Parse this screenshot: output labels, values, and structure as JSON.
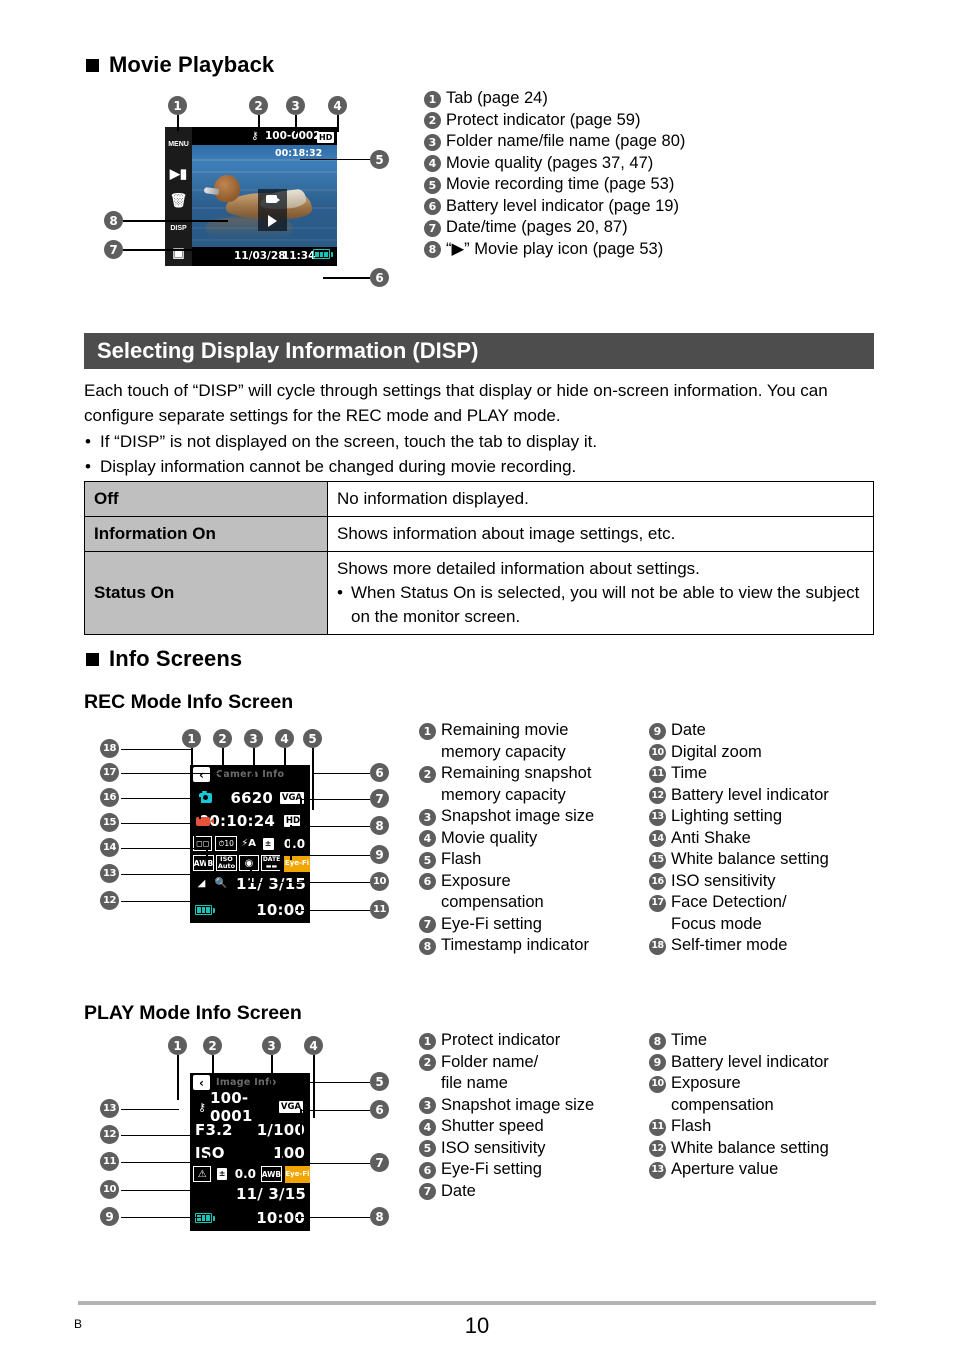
{
  "movie_playback": {
    "heading": "Movie Playback",
    "lcd": {
      "tab_buttons": [
        "MENU",
        "slideshow-icon",
        "delete-icon",
        "DISP",
        "rec-icon"
      ],
      "menu_label": "MENU",
      "disp_label": "DISP",
      "protect_icon": "protect-key-icon",
      "file_name": "100-0002",
      "movie_quality": "HD",
      "recording_time": "00:18:32",
      "date": "11/03/28",
      "time": "11:34",
      "play_icon": "play-triangle-icon",
      "movie_icon": "movie-camera-icon"
    },
    "legend": [
      {
        "n": "1",
        "text": "Tab (page 24)"
      },
      {
        "n": "2",
        "text": "Protect indicator (page 59)"
      },
      {
        "n": "3",
        "text": "Folder name/file name (page 80)"
      },
      {
        "n": "4",
        "text": "Movie quality (pages 37, 47)"
      },
      {
        "n": "5",
        "text": "Movie recording time (page 53)"
      },
      {
        "n": "6",
        "text": "Battery level indicator (page 19)"
      },
      {
        "n": "7",
        "text": "Date/time (pages 20, 87)"
      },
      {
        "n": "8",
        "text": "“▶” Movie play icon (page 53)"
      }
    ],
    "markers": [
      "1",
      "2",
      "3",
      "4",
      "5",
      "6",
      "7",
      "8"
    ]
  },
  "disp_section": {
    "bar_title": "Selecting Display Information (DISP)",
    "paragraph": "Each touch of “DISP” will cycle through settings that display or hide on-screen information. You can configure separate settings for the REC mode and PLAY mode.",
    "bullets": [
      "If “DISP” is not displayed on the screen, touch the tab to display it.",
      "Display information cannot be changed during movie recording."
    ],
    "table": [
      {
        "key": "Off",
        "value": "No information displayed.",
        "sub": null
      },
      {
        "key": "Information On",
        "value": "Shows information about image settings, etc.",
        "sub": null
      },
      {
        "key": "Status On",
        "value": "Shows more detailed information about settings.",
        "sub": "When Status On is selected, you will not be able to view the subject on the monitor screen."
      }
    ]
  },
  "info_screens": {
    "heading": "Info Screens",
    "rec": {
      "title": "REC Mode Info Screen",
      "lcd": {
        "header_title": "Camera Info",
        "back_icon": "back-chevron-icon",
        "snapshot_icon": "camera-icon",
        "snapshot_remaining": "6620",
        "snapshot_size": "VGA",
        "movie_icon": "movie-icon",
        "movie_remaining": "00:10:24",
        "movie_quality": "HD",
        "face_detect": "face-detect-icon",
        "self_timer": "10",
        "flash": "flash-auto-icon",
        "ev_icon": "ev-icon",
        "ev_value": "0.0",
        "white_balance": "AWB",
        "iso_label": "ISO",
        "iso_value": "Auto",
        "anti_shake": "anti-shake-icon",
        "timestamp": "DATE",
        "eyefi": "Eye-Fi",
        "lighting": "lighting-icon",
        "digital_zoom": "digital-zoom-icon",
        "date": "11/ 3/15",
        "battery": "battery-icon",
        "time": "10:00"
      },
      "legend_left": [
        {
          "n": "1",
          "text": "Remaining movie",
          "cont": "memory capacity"
        },
        {
          "n": "2",
          "text": "Remaining snapshot",
          "cont": "memory capacity"
        },
        {
          "n": "3",
          "text": "Snapshot image size",
          "cont": null
        },
        {
          "n": "4",
          "text": "Movie quality",
          "cont": null
        },
        {
          "n": "5",
          "text": "Flash",
          "cont": null
        },
        {
          "n": "6",
          "text": "Exposure",
          "cont": "compensation"
        },
        {
          "n": "7",
          "text": "Eye-Fi setting",
          "cont": null
        },
        {
          "n": "8",
          "text": "Timestamp indicator",
          "cont": null
        }
      ],
      "legend_right": [
        {
          "n": "9",
          "text": "Date",
          "cont": null
        },
        {
          "n": "10",
          "text": "Digital zoom",
          "cont": null
        },
        {
          "n": "11",
          "text": "Time",
          "cont": null
        },
        {
          "n": "12",
          "text": "Battery level indicator",
          "cont": null
        },
        {
          "n": "13",
          "text": "Lighting setting",
          "cont": null
        },
        {
          "n": "14",
          "text": "Anti Shake",
          "cont": null
        },
        {
          "n": "15",
          "text": "White balance setting",
          "cont": null
        },
        {
          "n": "16",
          "text": "ISO sensitivity",
          "cont": null
        },
        {
          "n": "17",
          "text": "Face Detection/",
          "cont": "Focus mode"
        },
        {
          "n": "18",
          "text": "Self-timer mode",
          "cont": null
        }
      ]
    },
    "play": {
      "title": "PLAY Mode Info Screen",
      "lcd": {
        "header_title": "Image Info",
        "back_icon": "back-chevron-icon",
        "protect_icon": "protect-key-icon",
        "file_name": "100-0001",
        "image_size": "VGA",
        "aperture": "F3.2",
        "shutter_speed": "1/100",
        "iso_label": "ISO",
        "iso_value": "100",
        "flash": "flash-off-icon",
        "ev_icon": "ev-icon",
        "ev_value": "0.0",
        "white_balance": "AWB",
        "eyefi": "Eye-Fi",
        "date": "11/ 3/15",
        "battery": "battery-icon",
        "time": "10:00"
      },
      "legend_left": [
        {
          "n": "1",
          "text": "Protect indicator",
          "cont": null
        },
        {
          "n": "2",
          "text": "Folder name/",
          "cont": "file name"
        },
        {
          "n": "3",
          "text": "Snapshot image size",
          "cont": null
        },
        {
          "n": "4",
          "text": "Shutter speed",
          "cont": null
        },
        {
          "n": "5",
          "text": "ISO sensitivity",
          "cont": null
        },
        {
          "n": "6",
          "text": "Eye-Fi setting",
          "cont": null
        },
        {
          "n": "7",
          "text": "Date",
          "cont": null
        }
      ],
      "legend_right": [
        {
          "n": "8",
          "text": "Time",
          "cont": null
        },
        {
          "n": "9",
          "text": "Battery level indicator",
          "cont": null
        },
        {
          "n": "10",
          "text": "Exposure",
          "cont": "compensation"
        },
        {
          "n": "11",
          "text": "Flash",
          "cont": null
        },
        {
          "n": "12",
          "text": "White balance setting",
          "cont": null
        },
        {
          "n": "13",
          "text": "Aperture value",
          "cont": null
        }
      ]
    }
  },
  "footer": {
    "mark": "B",
    "page_number": "10"
  }
}
